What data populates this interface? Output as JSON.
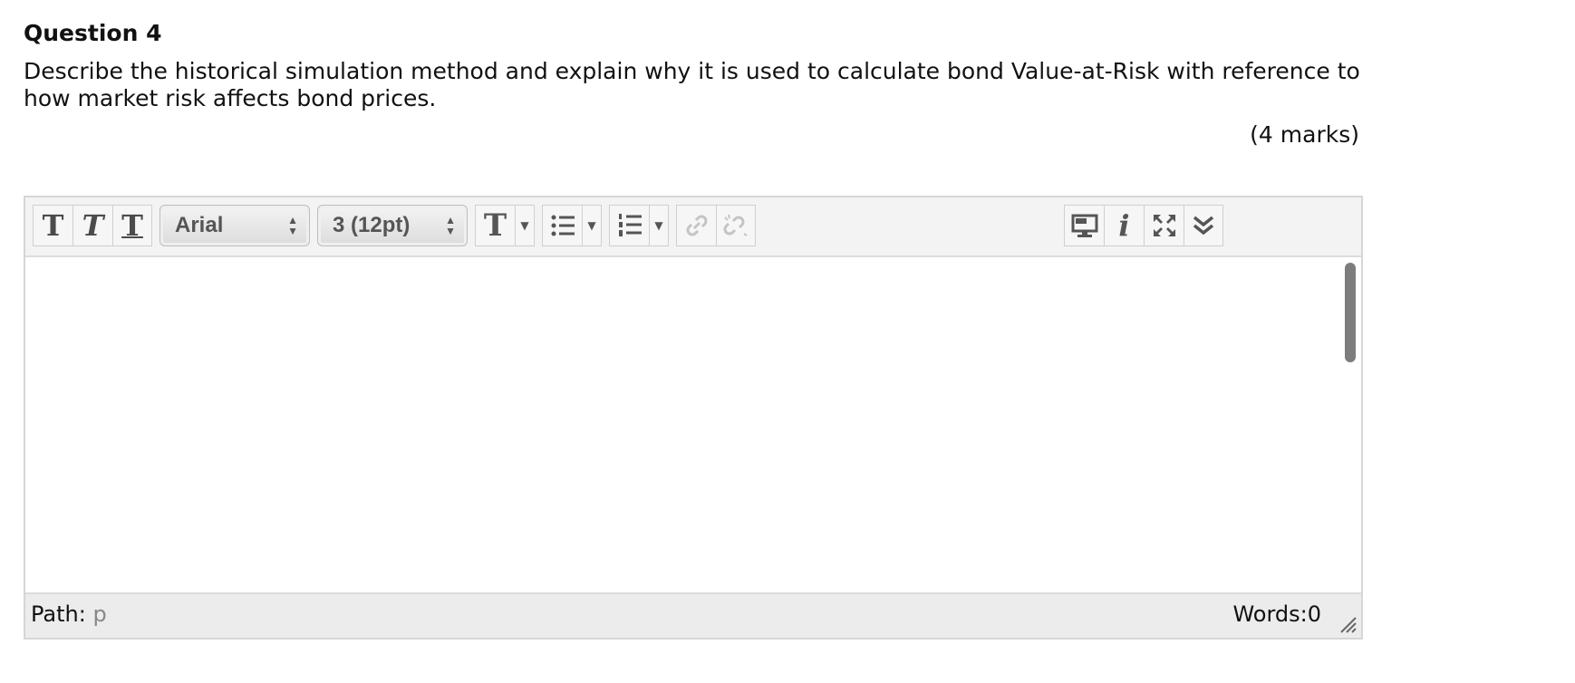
{
  "question": {
    "title": "Question 4",
    "text_line1": "Describe the historical simulation method and explain why it is used to calculate bond Value-at-Risk with reference to",
    "text_line2": "how market risk affects bond prices.",
    "marks": "(4 marks)"
  },
  "toolbar": {
    "bold": "T",
    "italic": "T",
    "underline": "T",
    "font_family": "Arial",
    "font_size": "3 (12pt)",
    "text_color": "T",
    "icons": [
      "bold-icon",
      "italic-icon",
      "underline-icon",
      "text-color-icon",
      "bullet-list-icon",
      "numbered-list-icon",
      "link-icon",
      "unlink-icon",
      "preview-icon",
      "info-icon",
      "fullscreen-icon",
      "expand-toolbar-icon"
    ]
  },
  "statusbar": {
    "path_label": "Path:",
    "path_value": "p",
    "words": "Words:0"
  }
}
